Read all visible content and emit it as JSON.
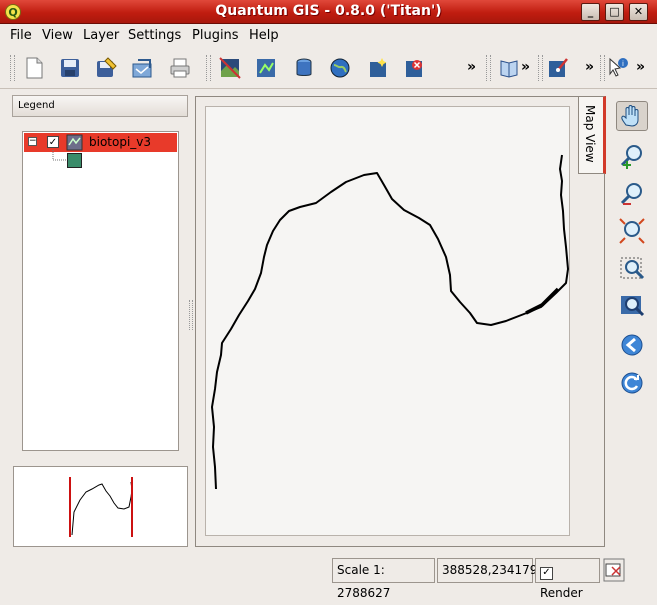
{
  "window": {
    "title": "Quantum GIS - 0.8.0 ('Titan')",
    "app_icon_letter": "Q",
    "minimize": "_",
    "maximize": "□",
    "close": "✕"
  },
  "menu": {
    "file": "File",
    "view": "View",
    "layer": "Layer",
    "settings": "Settings",
    "plugins": "Plugins",
    "help": "Help"
  },
  "toolbar": {
    "icons": [
      "new-project-icon",
      "save-project-icon",
      "save-as-icon",
      "export-icon",
      "print-icon",
      "add-raster-icon",
      "add-vector-icon",
      "add-database-icon",
      "add-wms-icon",
      "new-layer-icon",
      "remove-layer-icon",
      "help-book-icon",
      "capture-icon",
      "identify-icon"
    ],
    "overflow": "»"
  },
  "legend": {
    "header": "Legend",
    "layer_name": "biotopi_v3",
    "layer_checked": true,
    "symbol_color": "#3a8c6a",
    "expand": "−"
  },
  "map": {
    "tab_label": "Map View",
    "line_color": "#000000",
    "overview_extent_color": "#cc1111"
  },
  "map_tools": [
    "pan-icon",
    "zoom-in-icon",
    "zoom-out-icon",
    "zoom-full-icon",
    "zoom-selection-icon",
    "zoom-layer-icon",
    "zoom-last-icon",
    "refresh-icon"
  ],
  "status": {
    "scale": "Scale 1: 2788627",
    "coords": "388528,234179",
    "render_label": "Render",
    "render_checked": true
  },
  "colors": {
    "titlebar": "#c01d10",
    "selection": "#e83a2a",
    "background": "#efebe7"
  }
}
